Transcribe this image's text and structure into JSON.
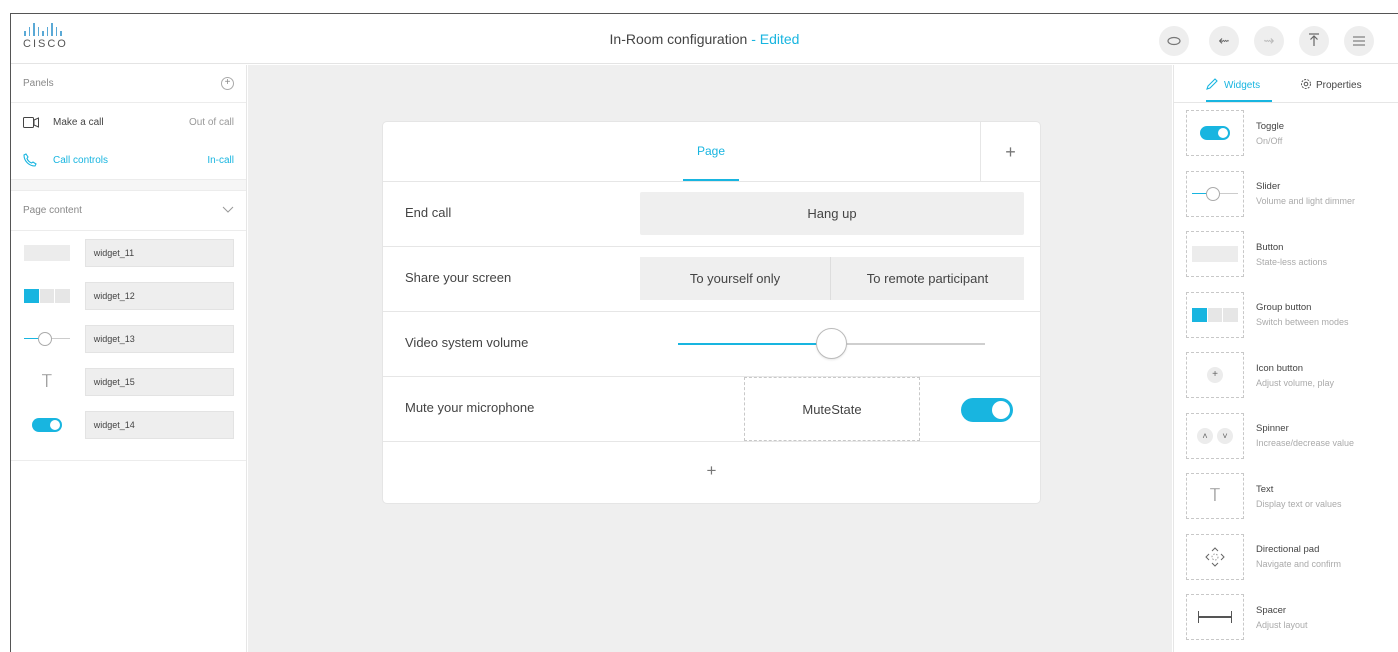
{
  "header": {
    "logo_text": "CISCO",
    "title": "In-Room configuration",
    "edited_suffix": "- Edited"
  },
  "left": {
    "panels_label": "Panels",
    "panels": [
      {
        "label": "Make a call",
        "state": "Out of call",
        "icon": "video-camera-icon",
        "active": false
      },
      {
        "label": "Call controls",
        "state": "In-call",
        "icon": "phone-icon",
        "active": true
      }
    ],
    "page_content_label": "Page content",
    "widgets": [
      {
        "name": "widget_11",
        "icon": "button-widget-icon"
      },
      {
        "name": "widget_12",
        "icon": "group-button-widget-icon"
      },
      {
        "name": "widget_13",
        "icon": "slider-widget-icon"
      },
      {
        "name": "widget_15",
        "icon": "text-widget-icon"
      },
      {
        "name": "widget_14",
        "icon": "toggle-widget-icon"
      }
    ]
  },
  "canvas": {
    "tab": "Page",
    "rows": [
      {
        "label": "End call",
        "button": "Hang up"
      },
      {
        "label": "Share your screen",
        "group": [
          "To yourself only",
          "To remote participant"
        ]
      },
      {
        "label": "Video system volume",
        "slider_value": 0.5
      },
      {
        "label": "Mute your microphone",
        "text": "MuteState",
        "toggle_on": true
      }
    ]
  },
  "right": {
    "tab_widgets": "Widgets",
    "tab_properties": "Properties",
    "palette": [
      {
        "name": "Toggle",
        "desc": "On/Off",
        "icon": "toggle-icon"
      },
      {
        "name": "Slider",
        "desc": "Volume and light dimmer",
        "icon": "slider-icon"
      },
      {
        "name": "Button",
        "desc": "State-less actions",
        "icon": "button-icon"
      },
      {
        "name": "Group button",
        "desc": "Switch between modes",
        "icon": "group-button-icon"
      },
      {
        "name": "Icon button",
        "desc": "Adjust volume, play",
        "icon": "icon-button-icon"
      },
      {
        "name": "Spinner",
        "desc": "Increase/decrease value",
        "icon": "spinner-icon"
      },
      {
        "name": "Text",
        "desc": "Display text or values",
        "icon": "text-icon"
      },
      {
        "name": "Directional pad",
        "desc": "Navigate and confirm",
        "icon": "directional-pad-icon"
      },
      {
        "name": "Spacer",
        "desc": "Adjust layout",
        "icon": "spacer-icon"
      }
    ]
  },
  "colors": {
    "accent": "#18b5e0",
    "canvas_bg": "#efefef"
  }
}
